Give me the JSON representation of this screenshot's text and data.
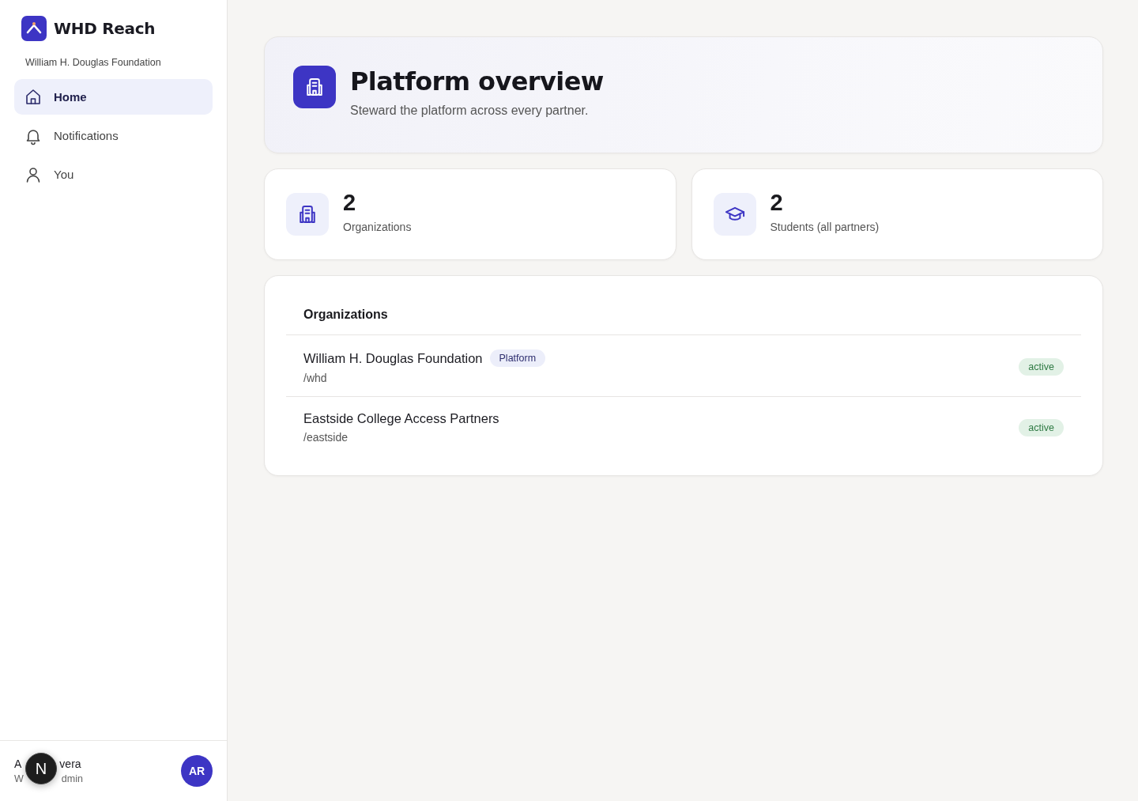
{
  "brand": {
    "name": "WHD Reach",
    "organization": "William H. Douglas Foundation"
  },
  "nav": [
    {
      "label": "Home",
      "selected": true
    },
    {
      "label": "Notifications",
      "selected": false
    },
    {
      "label": "You",
      "selected": false
    }
  ],
  "user": {
    "name_parts": [
      "A",
      "vera"
    ],
    "role_parts": [
      "W",
      "dmin"
    ],
    "initials": "AR"
  },
  "dev_badge": {
    "letter": "N"
  },
  "header": {
    "title": "Platform overview",
    "subtitle": "Steward the platform across every partner."
  },
  "stats": [
    {
      "value": "2",
      "label": "Organizations"
    },
    {
      "value": "2",
      "label": "Students (all partners)"
    }
  ],
  "organizations": {
    "title": "Organizations",
    "rows": [
      {
        "name": "William H. Douglas Foundation",
        "tag": "Platform",
        "slug": "/whd",
        "status": "active"
      },
      {
        "name": "Eastside College Access Partners",
        "slug": "/eastside",
        "status": "active"
      }
    ]
  }
}
